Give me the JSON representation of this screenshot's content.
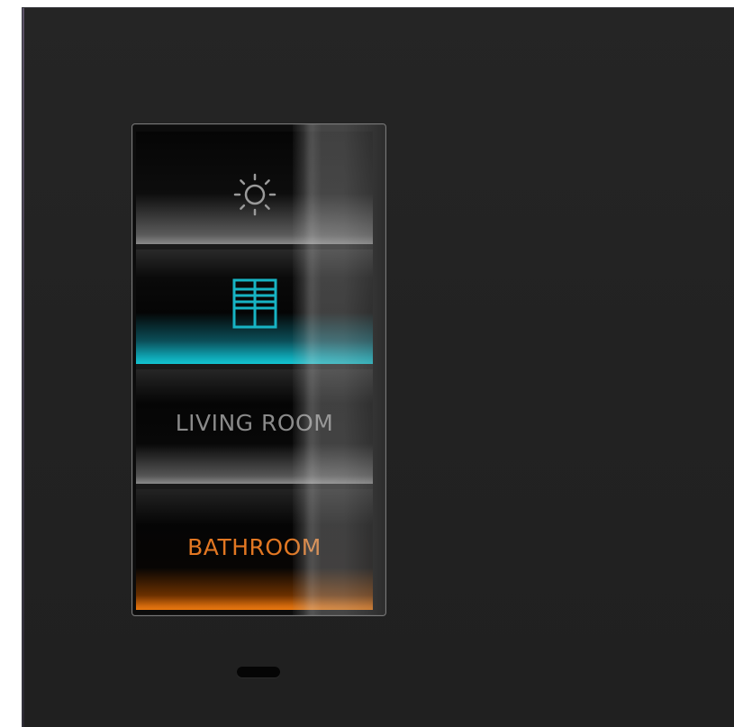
{
  "panel": {
    "tiles": [
      {
        "type": "icon",
        "icon": "sun-icon",
        "accent": "#9a9a9a"
      },
      {
        "type": "icon",
        "icon": "window-blinds-icon",
        "accent": "#17b4c4"
      },
      {
        "type": "text",
        "label": "LIVING ROOM",
        "accent": "#8a8a8a"
      },
      {
        "type": "text",
        "label": "BATHROOM",
        "accent": "#e27722"
      }
    ]
  },
  "colors": {
    "plate": "#232323",
    "cyan_glow": "#13c5d2",
    "orange_glow": "#e8780f"
  }
}
